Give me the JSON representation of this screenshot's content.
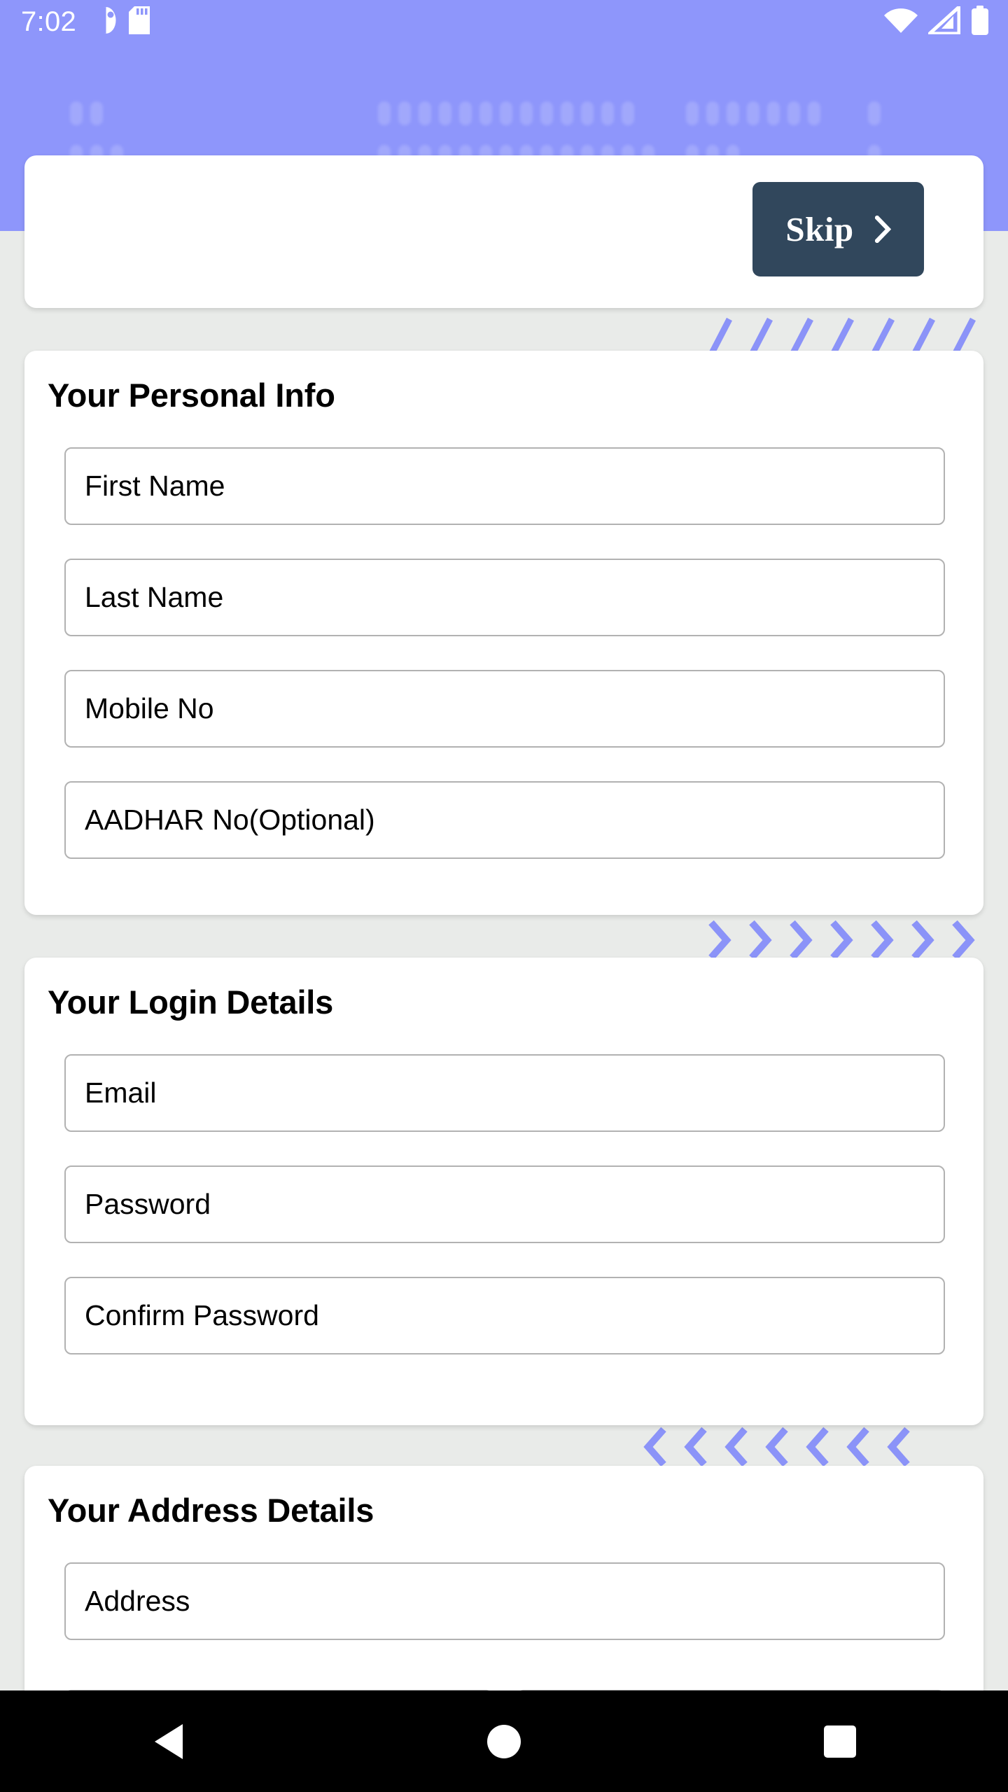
{
  "status_bar": {
    "time": "7:02",
    "icons": {
      "notification": "app-notification-icon",
      "sdcard": "sd-card-icon",
      "wifi": "wifi-icon",
      "signal": "cellular-signal-icon",
      "battery": "battery-full-icon"
    }
  },
  "theme": {
    "header_purple": "#8e96fb",
    "page_background": "#e9ebe9",
    "card_background": "#ffffff",
    "skip_button_background": "#31475c",
    "skip_button_text": "#ffffff",
    "field_border": "#b2b2b2",
    "text_primary": "#000000",
    "accent_decor": "#8b93f8",
    "navbar_background": "#000000"
  },
  "top_card": {
    "skip_label": "Skip",
    "skip_chevron_icon": "chevron-right-icon"
  },
  "sections": [
    {
      "id": "personal",
      "title": "Your Personal Info",
      "fields": [
        {
          "name": "first-name",
          "placeholder": "First Name",
          "value": ""
        },
        {
          "name": "last-name",
          "placeholder": "Last Name",
          "value": ""
        },
        {
          "name": "mobile-no",
          "placeholder": "Mobile No",
          "value": ""
        },
        {
          "name": "aadhar-no",
          "placeholder": "AADHAR No(Optional)",
          "value": ""
        }
      ]
    },
    {
      "id": "login",
      "title": "Your Login Details",
      "fields": [
        {
          "name": "email",
          "placeholder": "Email",
          "value": ""
        },
        {
          "name": "password",
          "placeholder": "Password",
          "value": ""
        },
        {
          "name": "confirm-password",
          "placeholder": "Confirm Password",
          "value": ""
        }
      ]
    },
    {
      "id": "address",
      "title": "Your Address Details",
      "fields": [
        {
          "name": "address",
          "placeholder": "Address",
          "value": ""
        }
      ]
    }
  ],
  "dividers": [
    {
      "name": "divider-slashes",
      "glyph": "slash"
    },
    {
      "name": "divider-chevrons-right",
      "glyph": "chevron-right"
    },
    {
      "name": "divider-chevrons-left",
      "glyph": "chevron-left"
    }
  ],
  "nav_bar": {
    "back": "back-triangle-icon",
    "home": "home-circle-icon",
    "recents": "recents-square-icon"
  }
}
